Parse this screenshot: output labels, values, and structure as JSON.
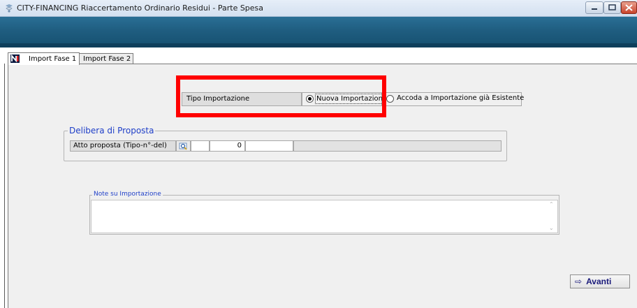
{
  "window": {
    "title": "CITY-FINANCING  Riaccertamento Ordinario Residui - Parte Spesa"
  },
  "tabs": [
    {
      "label": "Import Fase 1",
      "active": true
    },
    {
      "label": "Import  Fase 2",
      "active": false
    }
  ],
  "tipo_importazione": {
    "label": "Tipo Importazione",
    "options": [
      {
        "label": "Nuova Importazione",
        "selected": true
      },
      {
        "label": "Accoda a Importazione già Esistente",
        "selected": false
      }
    ]
  },
  "delibera": {
    "title": "Delibera di Proposta",
    "atto_label": "Atto proposta (Tipo-n°-del)",
    "tipo_value": "",
    "numero_value": "0",
    "data_value": "",
    "descrizione_value": ""
  },
  "note": {
    "title": "Note su Importazione",
    "value": ""
  },
  "buttons": {
    "avanti_label": "Avanti",
    "avanti_icon": "arrow-right-icon"
  },
  "colors": {
    "header_band": "#1f5d80",
    "highlight": "#ff0000",
    "group_title": "#1f3fc8"
  }
}
